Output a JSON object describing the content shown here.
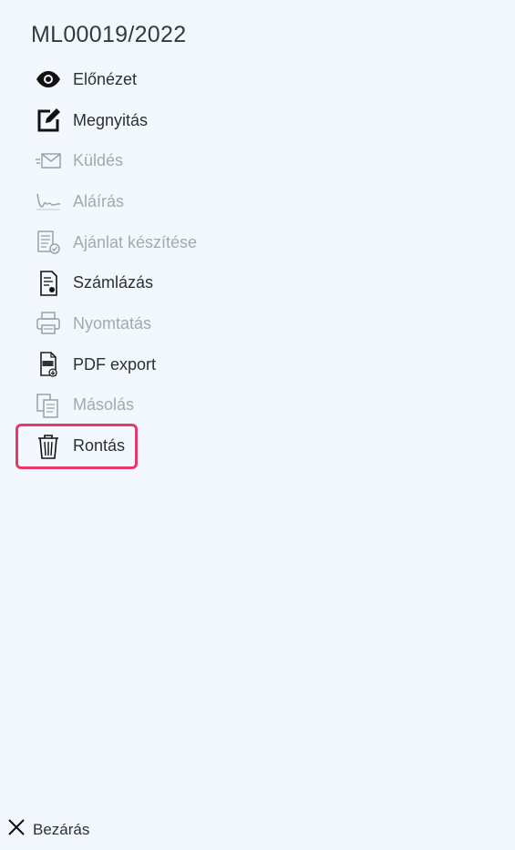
{
  "document_id": "ML00019/2022",
  "menu": {
    "items": [
      {
        "label": "Előnézet",
        "icon": "eye-icon",
        "enabled": true
      },
      {
        "label": "Megnyitás",
        "icon": "edit-icon",
        "enabled": true
      },
      {
        "label": "Küldés",
        "icon": "envelope-icon",
        "enabled": false
      },
      {
        "label": "Aláírás",
        "icon": "signature-icon",
        "enabled": false
      },
      {
        "label": "Ajánlat készítése",
        "icon": "checklist-icon",
        "enabled": false
      },
      {
        "label": "Számlázás",
        "icon": "invoice-icon",
        "enabled": true
      },
      {
        "label": "Nyomtatás",
        "icon": "printer-icon",
        "enabled": false
      },
      {
        "label": "PDF export",
        "icon": "pdf-icon",
        "enabled": true
      },
      {
        "label": "Másolás",
        "icon": "copy-icon",
        "enabled": false
      },
      {
        "label": "Rontás",
        "icon": "trash-icon",
        "enabled": true
      }
    ]
  },
  "close_label": "Bezárás",
  "colors": {
    "background": "#f2f8fe",
    "highlight": "#e8386b",
    "text": "#2b3036",
    "disabled_text": "#a3a9ae"
  }
}
